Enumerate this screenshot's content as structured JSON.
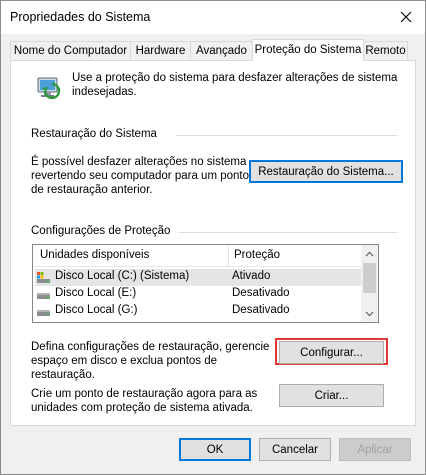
{
  "window": {
    "title": "Propriedades do Sistema"
  },
  "tabs": [
    {
      "label": "Nome do Computador"
    },
    {
      "label": "Hardware"
    },
    {
      "label": "Avançado"
    },
    {
      "label": "Proteção do Sistema",
      "active": true
    },
    {
      "label": "Remoto"
    }
  ],
  "intro": {
    "icon": "system-protection-icon",
    "line1": "Use a proteção do sistema para desfazer alterações de sistema",
    "line2": "indesejadas."
  },
  "restore_group": {
    "label": "Restauração do Sistema",
    "text_line1": "É possível desfazer alterações no sistema",
    "text_line2": "revertendo seu computador para um ponto",
    "text_line3": "de restauração anterior.",
    "button_label": "Restauração do Sistema..."
  },
  "protection_group": {
    "label": "Configurações de Proteção",
    "columns": [
      "Unidades disponíveis",
      "Proteção"
    ],
    "drives": [
      {
        "name": "Disco Local (C:) (Sistema)",
        "protection": "Ativado",
        "icon": "system-drive-icon"
      },
      {
        "name": "Disco Local (E:)",
        "protection": "Desativado",
        "icon": "drive-icon"
      },
      {
        "name": "Disco Local (G:)",
        "protection": "Desativado",
        "icon": "drive-icon"
      }
    ],
    "configure_text_line1": "Defina configurações de restauração, gerencie",
    "configure_text_line2": "espaço em disco e exclua pontos de",
    "configure_text_line3": "restauração.",
    "configure_button": "Configurar...",
    "create_text_line1": "Crie um ponto de restauração agora para as",
    "create_text_line2": "unidades com proteção de sistema ativada.",
    "create_button": "Criar..."
  },
  "footer": {
    "ok": "OK",
    "cancel": "Cancelar",
    "apply": "Aplicar"
  },
  "colors": {
    "highlight": "#e0392f",
    "focus_border": "#0078d7"
  }
}
